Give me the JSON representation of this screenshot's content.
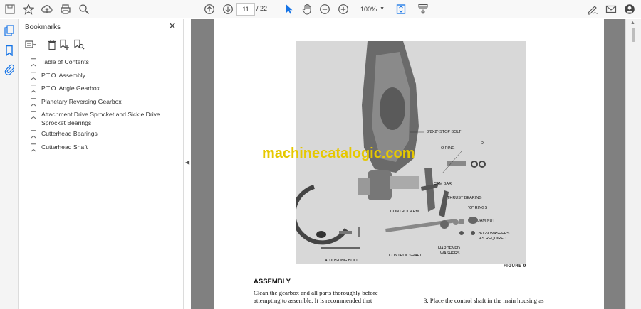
{
  "toolbar": {
    "page_current": "11",
    "page_total": "/ 22",
    "zoom": "100%"
  },
  "bookmarks": {
    "title": "Bookmarks",
    "items": [
      {
        "label": "Table of Contents"
      },
      {
        "label": "P.T.O. Assembly"
      },
      {
        "label": "P.T.O. Angle Gearbox"
      },
      {
        "label": "Planetary Reversing Gearbox"
      },
      {
        "label": "Attachment Drive Sprocket and Sickle Drive Sprocket Bearings"
      },
      {
        "label": "Cutterhead Bearings"
      },
      {
        "label": "Cutterhead Shaft"
      }
    ]
  },
  "document": {
    "figure_labels": {
      "stop_bolt": "3/8X2\"-STOP BOLT",
      "o_ring": "O RING",
      "d": "D",
      "cam_bar": "CAM BAR",
      "thrust_bearing": "THRUST BEARING",
      "control_arm": "CONTROL ARM",
      "o_rings": "\"O\" RINGS",
      "jam_nut": "JAM NUT",
      "washers": "26129 WASHERS",
      "as_required": "AS REQUIRED",
      "hardened": "HARDENED",
      "washers2": "WASHERS",
      "control_shaft": "CONTROL SHAFT",
      "adjusting_bolt": "ADJUSTING BOLT"
    },
    "figure_caption": "FIGURE 9",
    "watermark": "machinecatalogic.com",
    "heading": "ASSEMBLY",
    "body_left": "Clean the gearbox and all parts thoroughly before attempting to assemble. It is recommended that",
    "body_right": "3. Place the control shaft in the main housing as"
  },
  "colors": {
    "toolbar_bg": "#f8f8f8",
    "doc_bg": "#808080",
    "watermark": "#e6c800"
  }
}
